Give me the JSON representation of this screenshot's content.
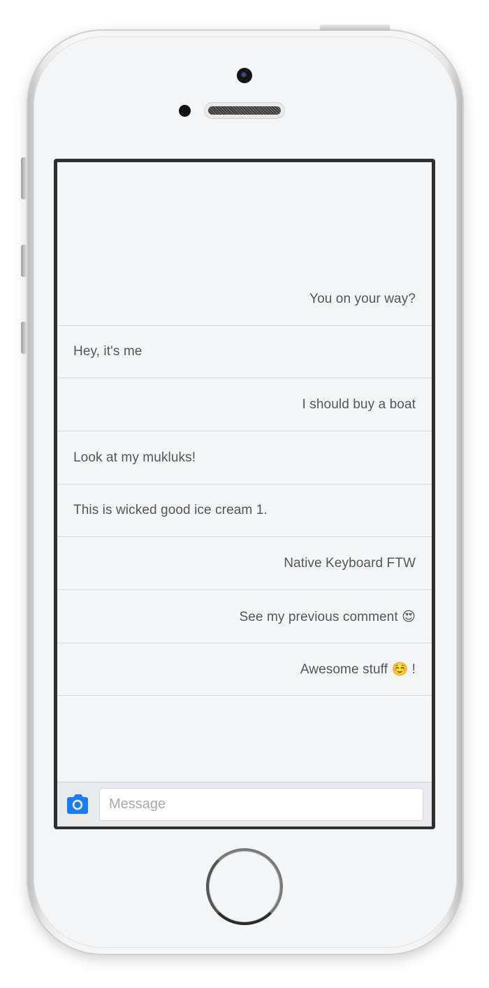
{
  "messages": [
    {
      "text": "You on your way?",
      "align": "right"
    },
    {
      "text": "Hey, it's me",
      "align": "left"
    },
    {
      "text": "I should buy a boat",
      "align": "right"
    },
    {
      "text": "Look at my mukluks!",
      "align": "left"
    },
    {
      "text": "This is wicked good ice cream 1.",
      "align": "left"
    },
    {
      "text": "Native Keyboard FTW",
      "align": "right"
    },
    {
      "text": "See my previous comment 😍",
      "align": "right"
    },
    {
      "text": "Awesome stuff ☺️ !",
      "align": "right"
    }
  ],
  "composer": {
    "placeholder": "Message",
    "value": "",
    "camera_icon": "camera-icon"
  },
  "colors": {
    "accent": "#1a7cf5",
    "message_text": "#555555",
    "divider": "#d6d6d6",
    "background": "#f4f5f7"
  }
}
